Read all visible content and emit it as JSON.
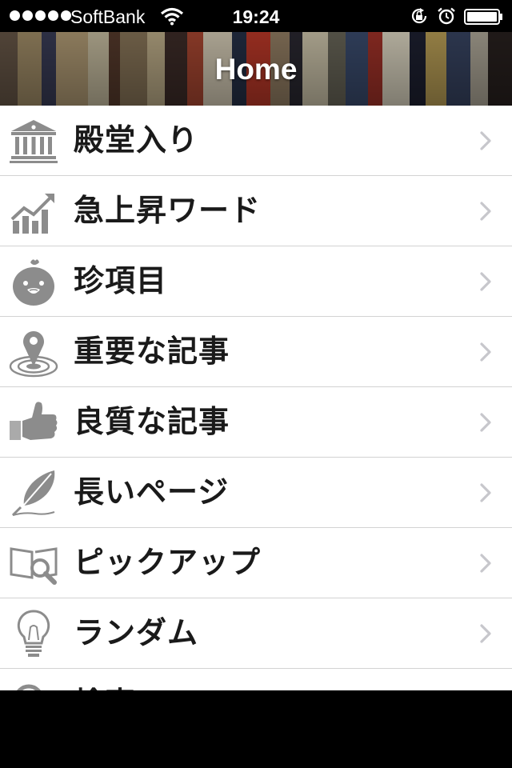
{
  "status_bar": {
    "carrier": "SoftBank",
    "time": "19:24",
    "signal_bars": 5,
    "icons": [
      "wifi-icon",
      "rotation-lock-icon",
      "alarm-icon",
      "battery-icon"
    ]
  },
  "nav": {
    "title": "Home"
  },
  "menu": {
    "items": [
      {
        "label": "殿堂入り",
        "icon": "hall-of-fame-icon"
      },
      {
        "label": "急上昇ワード",
        "icon": "trending-chart-icon"
      },
      {
        "label": "珍項目",
        "icon": "chick-icon"
      },
      {
        "label": "重要な記事",
        "icon": "location-pin-icon"
      },
      {
        "label": "良質な記事",
        "icon": "thumbs-up-icon"
      },
      {
        "label": "長いページ",
        "icon": "quill-icon"
      },
      {
        "label": "ピックアップ",
        "icon": "book-magnifier-icon"
      },
      {
        "label": "ランダム",
        "icon": "lightbulb-icon"
      },
      {
        "label": "検索",
        "icon": "search-icon"
      }
    ]
  },
  "colors": {
    "icon_gray": "#8c8c8c",
    "chevron": "#c7c7cc",
    "divider": "#d2d2d2"
  }
}
